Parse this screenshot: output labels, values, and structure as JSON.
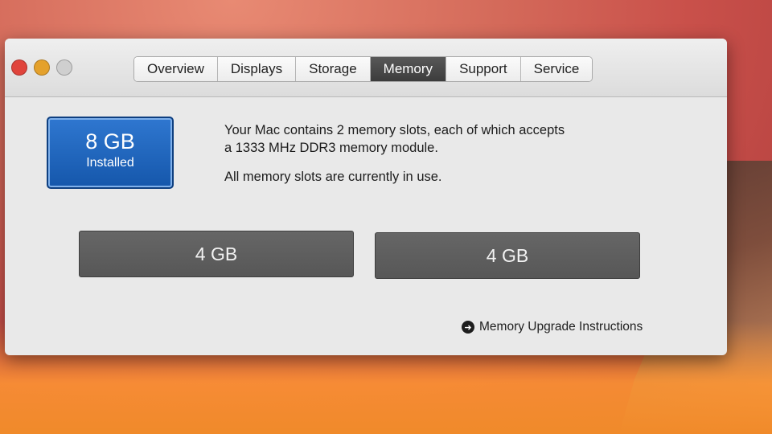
{
  "tabs": [
    "Overview",
    "Displays",
    "Storage",
    "Memory",
    "Support",
    "Service"
  ],
  "active_tab": "Memory",
  "installed": {
    "amount": "8 GB",
    "label": "Installed"
  },
  "description": {
    "line1": "Your Mac contains 2 memory slots, each of which accepts",
    "line2": "a 1333 MHz DDR3 memory module.",
    "note": "All memory slots are currently in use."
  },
  "slots": [
    "4 GB",
    "4 GB"
  ],
  "upgrade_link": "Memory Upgrade Instructions",
  "icons": {
    "arrow": "arrow-circle-right-icon"
  }
}
